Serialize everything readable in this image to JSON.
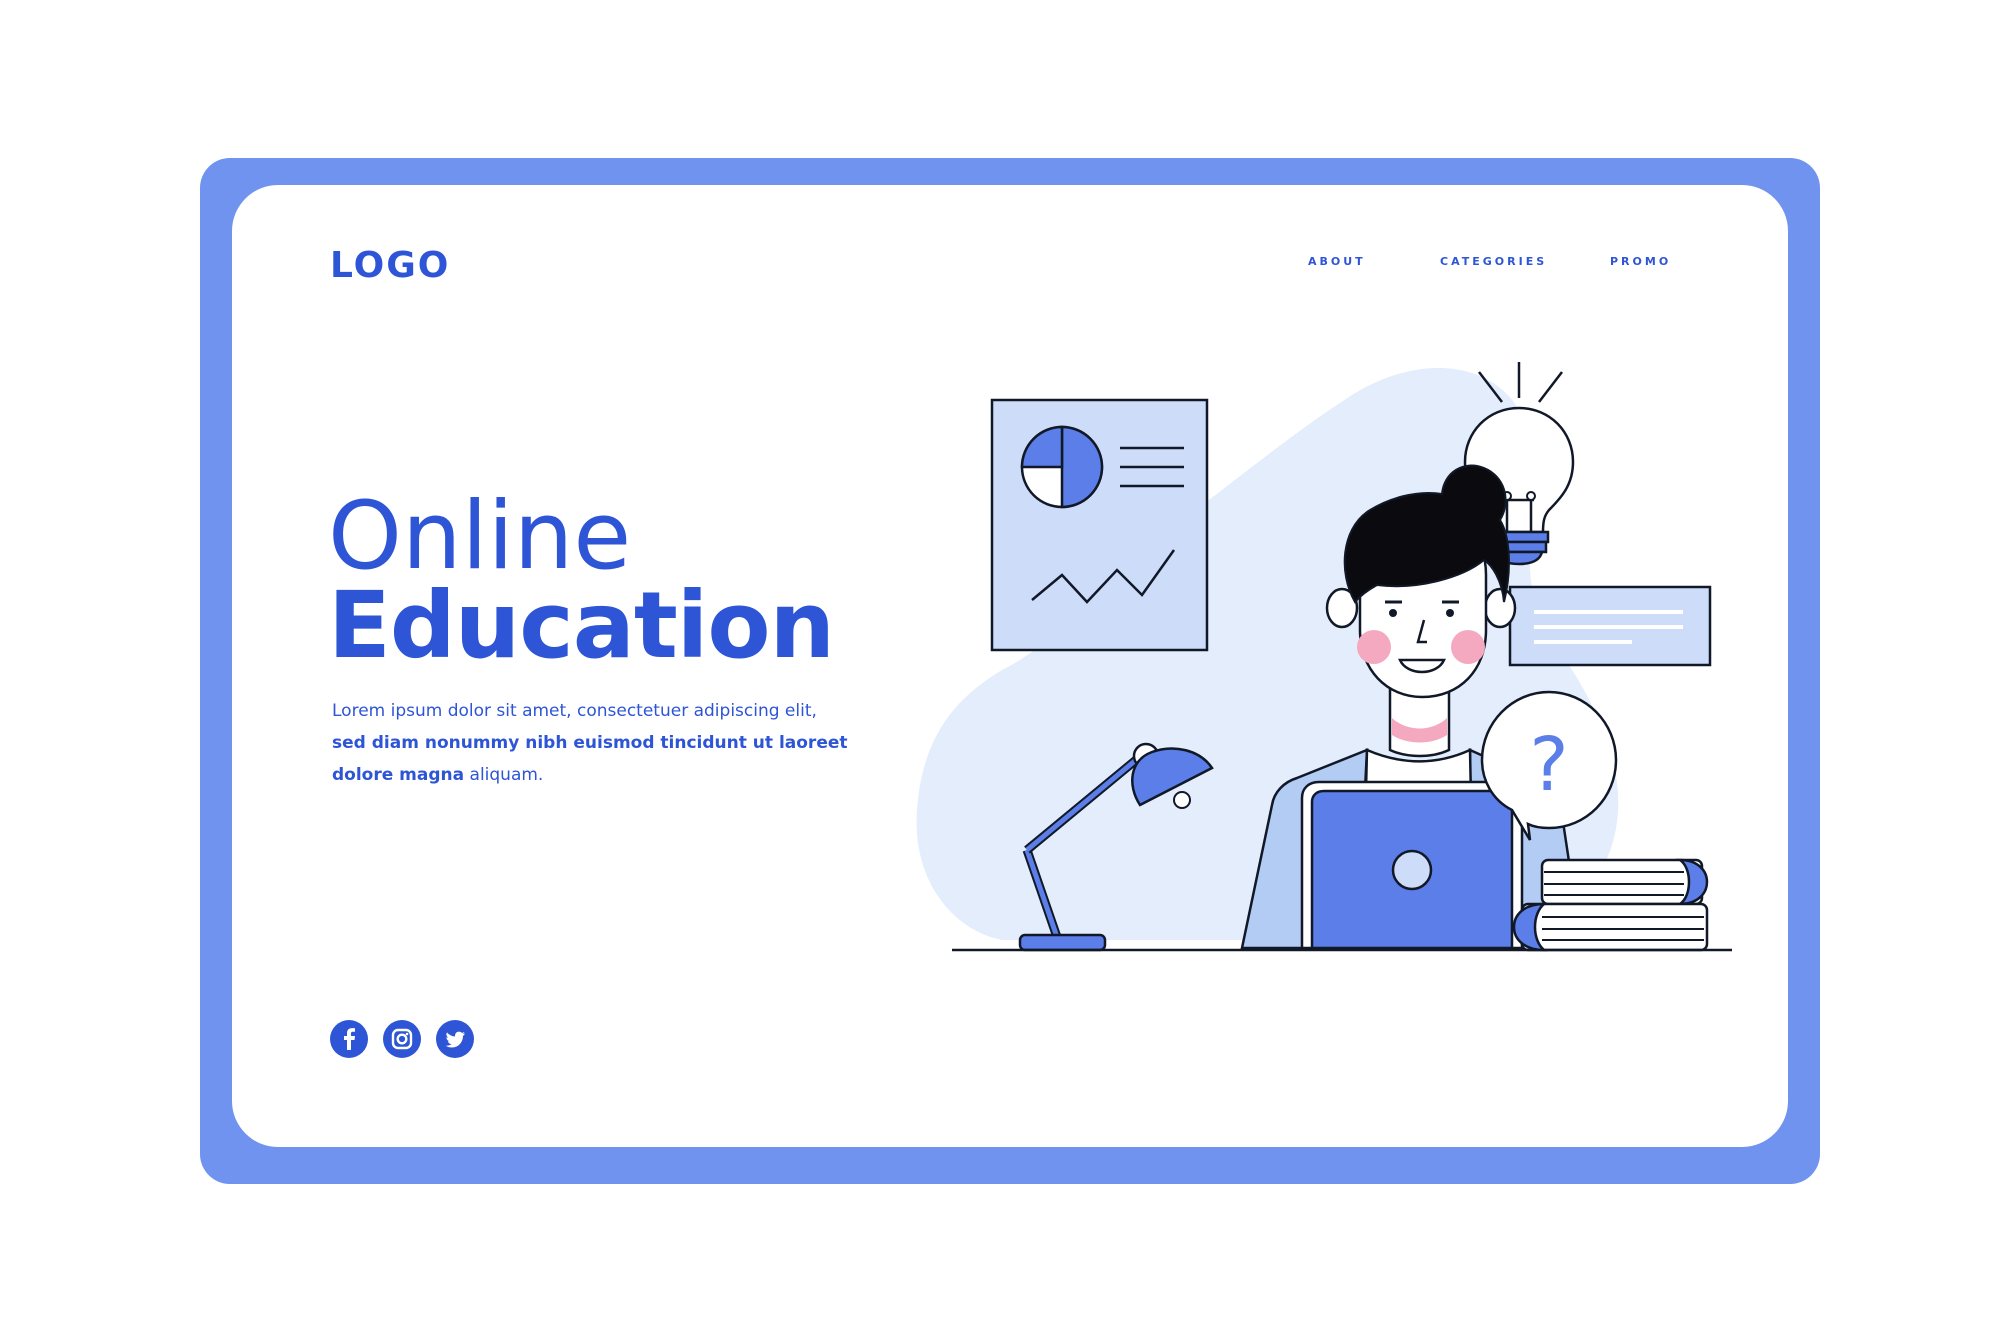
{
  "header": {
    "logo": "LOGO",
    "nav": [
      "ABOUT",
      "CATEGORIES",
      "PROMO"
    ]
  },
  "hero": {
    "title_line1": "Online",
    "title_line2": "Education",
    "description_normal_1": "Lorem ipsum dolor sit amet, consectetuer adipiscing elit, ",
    "description_bold": "sed diam nonummy nibh euismod tincidunt ut laoreet dolore magna",
    "description_normal_2": " aliquam."
  },
  "social": {
    "icons": [
      "facebook-icon",
      "instagram-icon",
      "twitter-icon"
    ]
  },
  "illustration": {
    "bubble_text": "?"
  },
  "colors": {
    "accent": "#2d55d6",
    "frame": "#6f93ee",
    "light_blue": "#cddcf8",
    "blob": "#e3edfc",
    "cheek": "#f4a9c0"
  }
}
